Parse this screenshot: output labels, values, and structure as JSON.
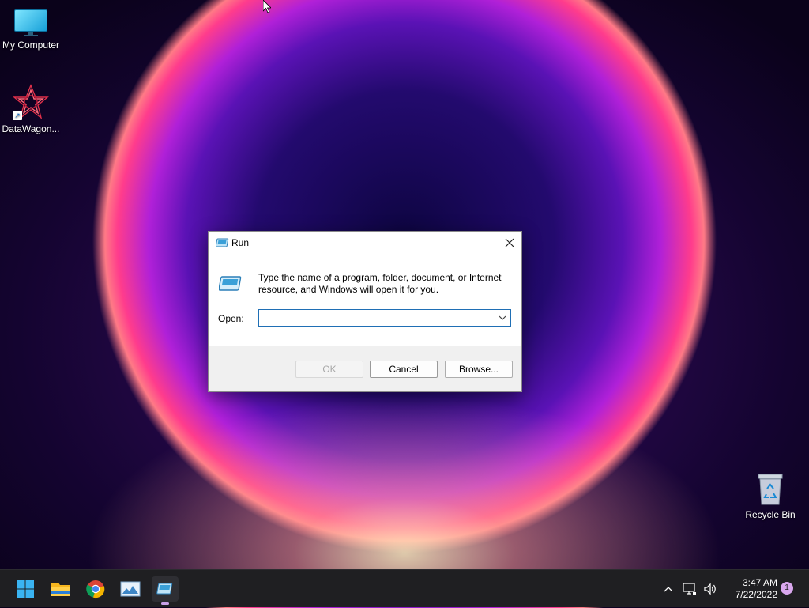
{
  "desktop": {
    "icons": [
      {
        "label": "My Computer"
      },
      {
        "label": "DataWagon..."
      },
      {
        "label": "Recycle Bin"
      }
    ]
  },
  "run_dialog": {
    "title": "Run",
    "description": "Type the name of a program, folder, document, or Internet resource, and Windows will open it for you.",
    "open_label": "Open:",
    "open_value": "",
    "buttons": {
      "ok": "OK",
      "cancel": "Cancel",
      "browse": "Browse..."
    }
  },
  "taskbar": {
    "icons": [
      "windows-start-icon",
      "file-explorer-icon",
      "chrome-icon",
      "photos-icon",
      "run-icon"
    ],
    "time": "3:47 AM",
    "date": "7/22/2022",
    "notification_count": "1"
  },
  "colors": {
    "accent": "#1f6fb5",
    "taskbar": "#1f1f22",
    "badge": "#d9a7ee"
  }
}
